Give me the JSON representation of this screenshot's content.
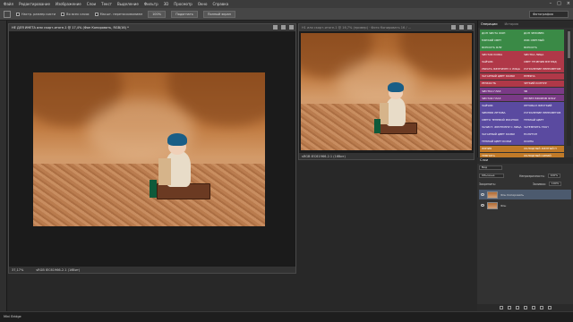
{
  "menu": [
    "Файл",
    "Редактирование",
    "Изображение",
    "Слои",
    "Текст",
    "Выделение",
    "Фильтр",
    "3D",
    "Просмотр",
    "Окно",
    "Справка"
  ],
  "options": {
    "sample": "Настр. размер кисти",
    "all_layers": "Во всех слоях",
    "scrubby": "Масшт. перетаскиванием",
    "zoom_100": "100%",
    "fit": "Подогнать",
    "fill": "Полный экран",
    "workspace": "Фотография"
  },
  "doc1": {
    "title": "НЕ ДЛЯ ИНЕТА или скорт-итоге-1 @ 17,4% (Фон Копировать, RGB/16) *",
    "zoom": "37,17%",
    "profile": "sRGB IEC61966-2.1 (16бит)"
  },
  "doc2": {
    "title": "Н1 или скорт-итоге-1 @ 16,7% (пример) · Фото Копировать 16 / ...",
    "profile": "sRGB IEC61966-2.1 (16бит)"
  },
  "panel_tabs": [
    "Операции",
    "История"
  ],
  "actions": [
    {
      "left": "ДОН ЧИСТА ФОН",
      "right": "ДОН ЧЕЛОВЕК",
      "color": "#3a8a46"
    },
    {
      "left": "МЯГКИЙ СВЕТ",
      "right": "ЛИК СВЕТЛЫЙ",
      "color": "#3a8a46"
    },
    {
      "left": "ЯСНОСТЬ ФЛУ",
      "right": "ЯСНОСТЬ",
      "color": "#3a8a46"
    },
    {
      "left": "ЧИСТАЯ КОЖА",
      "right": "ЧИСТКА ЛИЦА",
      "color": "#b03848"
    },
    {
      "left": "ЗАЙЧИК",
      "right": "СВЕТ ТЕЧЕНИЯ ВЗГЛЯД",
      "color": "#b03848"
    },
    {
      "left": "УБРАТЬ ЖЕЛТИЗНУ С ЛИЦА",
      "right": "УСТРАНЕНИЕ ПЕРЕСВЕТОВ",
      "color": "#b03848"
    },
    {
      "left": "ЗАГАРНЫЙ ЦВЕТ КОЖИ",
      "right": "РУМЯНА",
      "color": "#b03848"
    },
    {
      "left": "РЕЗКОСТЬ",
      "right": "ЧЕТКИЙ КОНТУР",
      "color": "#b03848"
    },
    {
      "left": "ЧИСТКА ГЛАЗ",
      "right": "ЧБ",
      "color": "#7a3a86"
    },
    {
      "left": "ЧИСТАЯ ГЛАЗ",
      "right": "ЛИ БЕЗ ЕЖИРОВ ФЛАУ",
      "color": "#7a3a86"
    },
    {
      "left": "ЗАЙЧИК",
      "right": "ЛЕТОВАЛ ЖЕСТКИЙ",
      "color": "#5a4aa0"
    },
    {
      "left": "ЗИМНЯЯ ЛЕТОВА",
      "right": "УСТРАНЕНИЕ ПЕРЕСВЕТОВ",
      "color": "#5a4aa0"
    },
    {
      "left": "СВЕТО ТЕНЕВОЙ РИСУНОК",
      "right": "ТЕПЛЫЙ ЦВЕТ",
      "color": "#5a4aa0"
    },
    {
      "left": "ЗАЧИСТ. ЖЕЛТИЗНУ С ЛИЦА",
      "right": "ЗАТЕМНИТЬ ГРАН",
      "color": "#5a4aa0"
    },
    {
      "left": "ЗАГАРНЫЙ ЦВЕТ КОЖИ",
      "right": "ПОЛУТОН",
      "color": "#5a4aa0"
    },
    {
      "left": "ТЕПЛЫЙ ЦВЕТ КОЖИ",
      "right": "ОСИНА",
      "color": "#5a4aa0"
    },
    {
      "left": "ЛИНИЯ",
      "right": "ХОЛОДНЫЙ ЖЕЛТЫЙ Н",
      "color": "#c07a28"
    },
    {
      "left": "ТЕМНОТА",
      "right": "ХОЛОДНЫЙ СИНИЙ",
      "color": "#c07a28"
    },
    {
      "left": "ТЕПЛЫЙ ОТТЕНОК",
      "right": "ОСИНА",
      "color": "#c07a28"
    },
    {
      "left": "ЯРКИЙ",
      "right": "К ЧЕРНЫЕ ТОНА",
      "color": "#c07a28"
    }
  ],
  "layers": {
    "title": "Слои",
    "kind": "Вид",
    "blend": "Обычные",
    "opacity_label": "Непрозрачность:",
    "opacity": "100%",
    "lock_label": "Закрепить:",
    "fill_label": "Заливка:",
    "fill": "100%",
    "items": [
      {
        "name": "Фон Копировать",
        "selected": true
      },
      {
        "name": "Фон",
        "selected": false
      }
    ]
  },
  "bridge": "Mini Bridge"
}
